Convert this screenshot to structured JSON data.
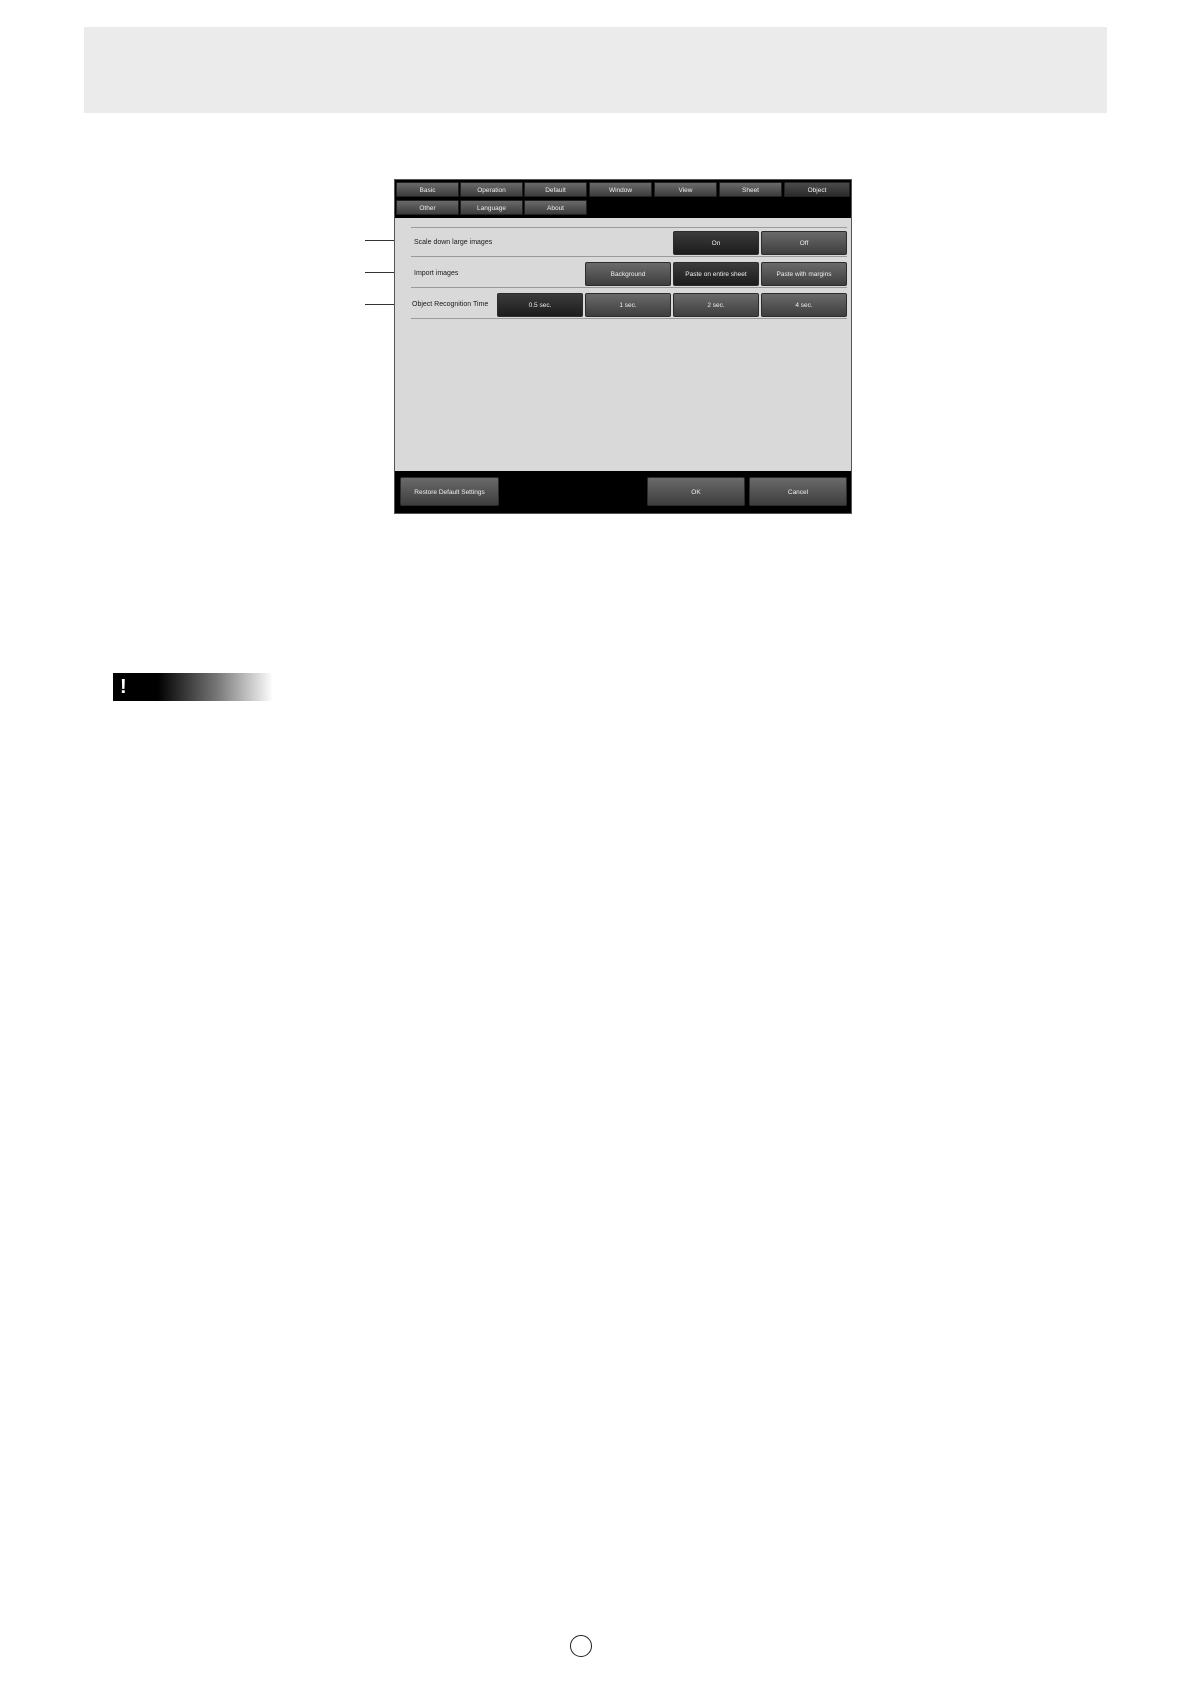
{
  "dialog": {
    "tabs_row1": [
      "Basic",
      "Operation",
      "Default",
      "Window",
      "View",
      "Sheet",
      "Object"
    ],
    "tabs_row2": [
      "Other",
      "Language",
      "About"
    ],
    "selected_tab": "Object",
    "rows": [
      {
        "label": "Scale down large images",
        "options": [
          "On",
          "Off"
        ],
        "selected": "On"
      },
      {
        "label": "Import images",
        "options": [
          "Background",
          "Paste on entire sheet",
          "Paste with margins"
        ],
        "selected": "Paste on entire sheet"
      },
      {
        "label": "Object Recognition Time",
        "options": [
          "0.5 sec.",
          "1 sec.",
          "2 sec.",
          "4 sec."
        ],
        "selected": "0.5 sec."
      }
    ],
    "footer": {
      "restore": "Restore Default Settings",
      "ok": "OK",
      "cancel": "Cancel"
    }
  },
  "caution": {
    "mark": "!"
  },
  "colors": {
    "header_band": "#ebebeb",
    "dialog_bg": "#d9d9d9",
    "bar": "#000000",
    "button": "#4a4a4a"
  }
}
